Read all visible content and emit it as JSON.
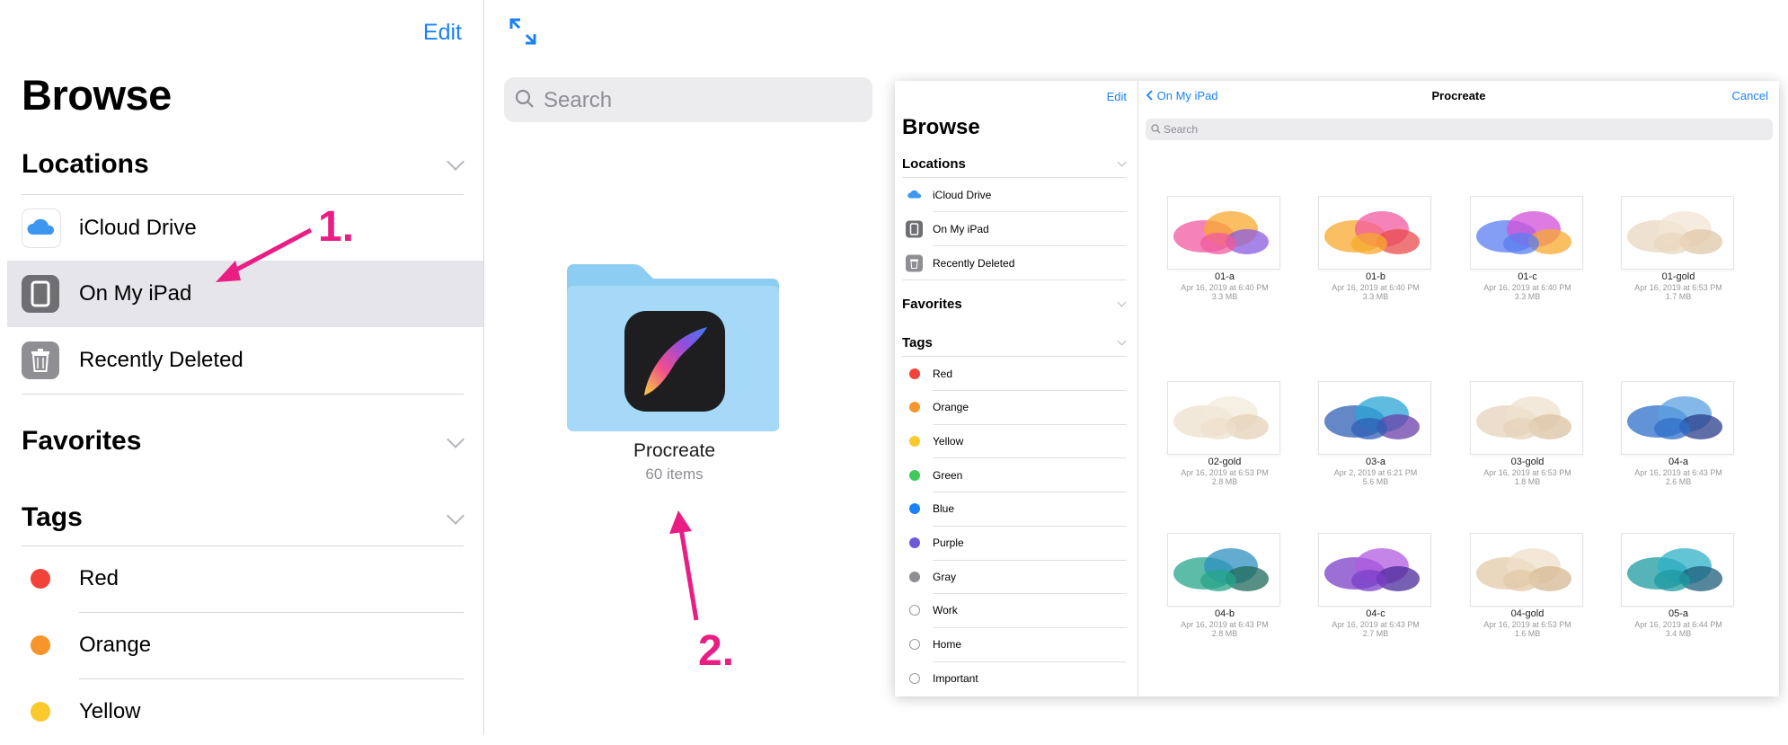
{
  "left": {
    "edit_label": "Edit",
    "browse_title": "Browse",
    "sections": {
      "locations": "Locations",
      "favorites": "Favorites",
      "tags": "Tags"
    },
    "locations": [
      {
        "label": "iCloud Drive",
        "icon": "icloud-icon"
      },
      {
        "label": "On My iPad",
        "icon": "ipad-icon",
        "selected": true
      },
      {
        "label": "Recently Deleted",
        "icon": "trash-icon"
      }
    ],
    "tags": [
      {
        "label": "Red",
        "color": "#f2423a"
      },
      {
        "label": "Orange",
        "color": "#f7952c"
      },
      {
        "label": "Yellow",
        "color": "#f9c92e"
      }
    ],
    "search_placeholder": "Search",
    "folder": {
      "name": "Procreate",
      "count": "60 items",
      "icon": "procreate-folder-icon"
    }
  },
  "annotations": {
    "step1": "1.",
    "step2": "2.",
    "color": "#ea1d84"
  },
  "right": {
    "edit_label": "Edit",
    "browse_title": "Browse",
    "sections": {
      "locations": "Locations",
      "favorites": "Favorites",
      "tags": "Tags"
    },
    "locations": [
      {
        "label": "iCloud Drive",
        "icon": "icloud-icon"
      },
      {
        "label": "On My iPad",
        "icon": "ipad-icon"
      },
      {
        "label": "Recently Deleted",
        "icon": "trash-icon"
      }
    ],
    "tags": [
      {
        "label": "Red",
        "color": "#f2423a"
      },
      {
        "label": "Orange",
        "color": "#f7952c"
      },
      {
        "label": "Yellow",
        "color": "#f9c92e"
      },
      {
        "label": "Green",
        "color": "#3ec95a"
      },
      {
        "label": "Blue",
        "color": "#1a82f6"
      },
      {
        "label": "Purple",
        "color": "#6b5bd6"
      },
      {
        "label": "Gray",
        "color": "#8e8e93"
      },
      {
        "label": "Work",
        "color": ""
      },
      {
        "label": "Home",
        "color": ""
      },
      {
        "label": "Important",
        "color": ""
      }
    ],
    "nav": {
      "back_label": "On My iPad",
      "title": "Procreate",
      "cancel_label": "Cancel"
    },
    "search_placeholder": "Search",
    "files": [
      {
        "name": "01-a",
        "date": "Apr 16, 2019 at 6:40 PM",
        "size": "3.3 MB",
        "palette": [
          "#f05aa0",
          "#f7a92e",
          "#8a5be0"
        ]
      },
      {
        "name": "01-b",
        "date": "Apr 16, 2019 at 6:40 PM",
        "size": "3.3 MB",
        "palette": [
          "#f7a92e",
          "#f05aa0",
          "#e94b4b"
        ]
      },
      {
        "name": "01-c",
        "date": "Apr 16, 2019 at 6:40 PM",
        "size": "3.3 MB",
        "palette": [
          "#5a7df0",
          "#d34fd8",
          "#f7a92e"
        ]
      },
      {
        "name": "01-gold",
        "date": "Apr 16, 2019 at 6:53 PM",
        "size": "1.7 MB",
        "palette": [
          "#ead7bf",
          "#f2e6d4",
          "#e0c7a8"
        ]
      },
      {
        "name": "02-gold",
        "date": "Apr 16, 2019 at 6:53 PM",
        "size": "2.8 MB",
        "palette": [
          "#eee0cc",
          "#f3ead9",
          "#e4d2b8"
        ]
      },
      {
        "name": "03-a",
        "date": "Apr 2, 2019 at 6:21 PM",
        "size": "5.6 MB",
        "palette": [
          "#2f5fb4",
          "#2aa6d6",
          "#6a3fa8"
        ]
      },
      {
        "name": "03-gold",
        "date": "Apr 16, 2019 at 6:53 PM",
        "size": "1.8 MB",
        "palette": [
          "#e6d2bb",
          "#efe2cf",
          "#d9c1a2"
        ]
      },
      {
        "name": "04-a",
        "date": "Apr 16, 2019 at 6:43 PM",
        "size": "2.6 MB",
        "palette": [
          "#2f6fc9",
          "#5aa0e0",
          "#2a3e8a"
        ]
      },
      {
        "name": "04-b",
        "date": "Apr 16, 2019 at 6:43 PM",
        "size": "2.8 MB",
        "palette": [
          "#27a58a",
          "#2f8fbf",
          "#1e6a5a"
        ]
      },
      {
        "name": "04-c",
        "date": "Apr 16, 2019 at 6:43 PM",
        "size": "2.7 MB",
        "palette": [
          "#7a3fc8",
          "#b05be0",
          "#4a2a9a"
        ]
      },
      {
        "name": "04-gold",
        "date": "Apr 16, 2019 at 6:53 PM",
        "size": "1.6 MB",
        "palette": [
          "#e2c9a8",
          "#efe0cb",
          "#d6b892"
        ]
      },
      {
        "name": "05-a",
        "date": "Apr 16, 2019 at 6:44 PM",
        "size": "3.4 MB",
        "palette": [
          "#1e9aa0",
          "#2fb0c8",
          "#1c5e7a"
        ]
      }
    ]
  }
}
